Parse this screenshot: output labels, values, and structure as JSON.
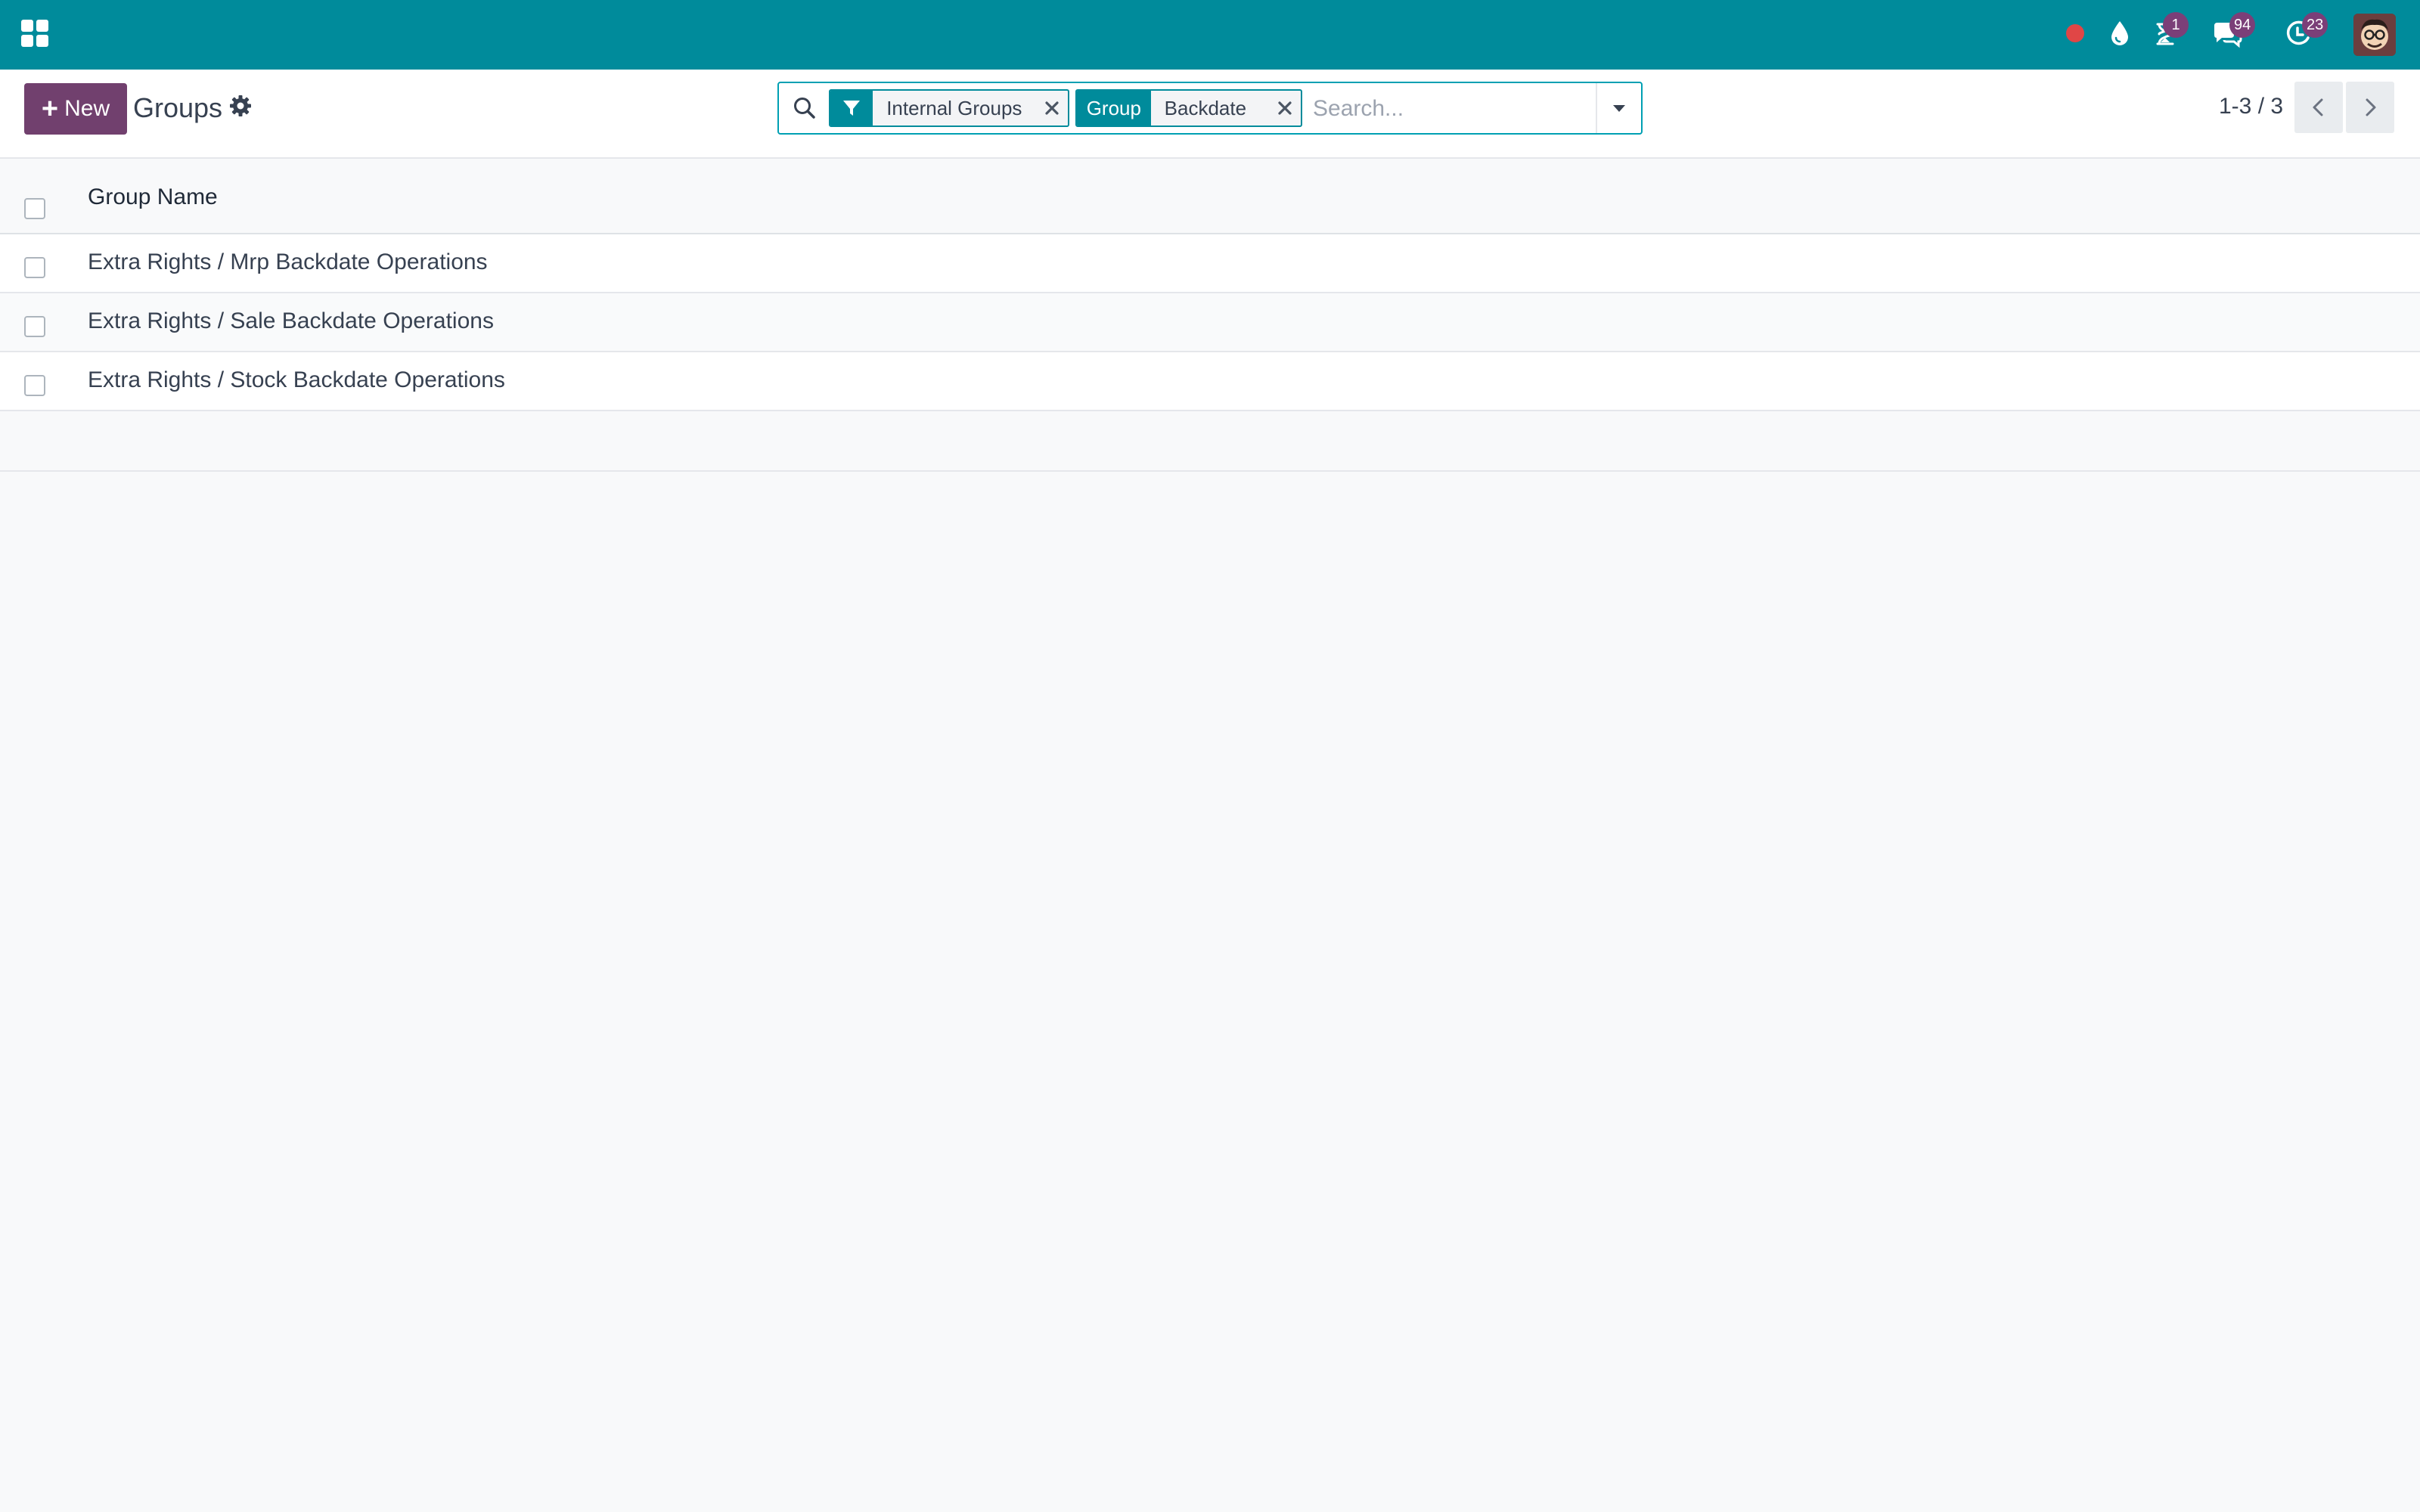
{
  "navbar": {
    "apps_icon": "apps-grid-icon",
    "systray": [
      {
        "icon": "recording-dot-icon",
        "color": "#e04646",
        "badge": ""
      },
      {
        "icon": "droplet-icon",
        "badge": ""
      },
      {
        "icon": "hourglass-icon",
        "badge": "1"
      },
      {
        "icon": "chat-bubbles-icon",
        "badge": "94"
      },
      {
        "icon": "activity-clock-icon",
        "badge": "23"
      }
    ],
    "avatar": "user-avatar"
  },
  "control_panel": {
    "new_button_label": "New",
    "title": "Groups",
    "settings_icon": "gear-icon",
    "search": {
      "facets": [
        {
          "type": "filter",
          "tag_icon": "filter-icon",
          "value": "Internal Groups"
        },
        {
          "type": "field",
          "tag_label": "Group",
          "value": "Backdate"
        }
      ],
      "placeholder": "Search...",
      "value": ""
    },
    "pager": {
      "value": "1-3 / 3"
    }
  },
  "list": {
    "columns": [
      "Group Name"
    ],
    "rows": [
      {
        "name": "Extra Rights / Mrp Backdate Operations"
      },
      {
        "name": "Extra Rights / Sale Backdate Operations"
      },
      {
        "name": "Extra Rights / Stock Backdate Operations"
      }
    ]
  },
  "colors": {
    "navbar": "#008b9b",
    "primary": "#71406e",
    "badge": "#7b3f78",
    "background": "#f8f9fa"
  }
}
